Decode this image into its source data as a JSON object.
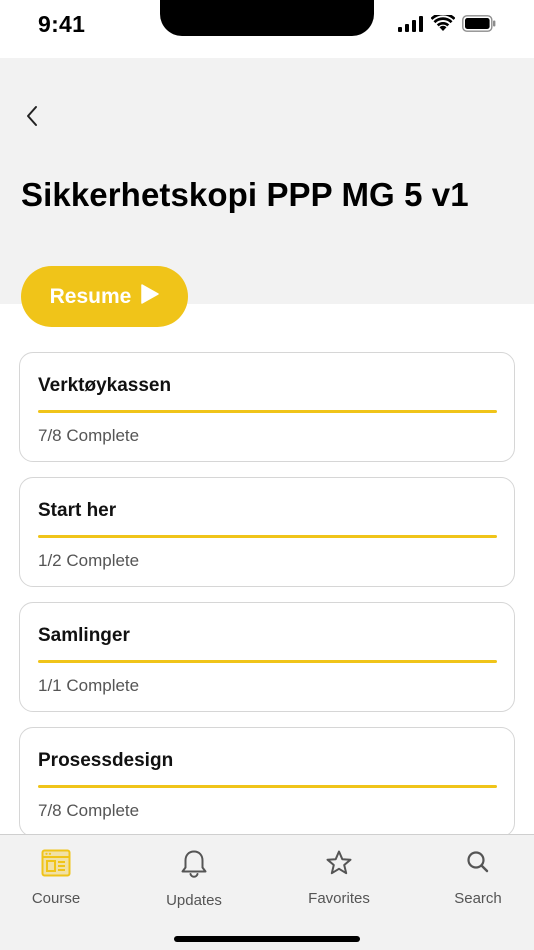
{
  "status_bar": {
    "time": "9:41"
  },
  "header": {
    "title": "Sikkerhetskopi PPP MG 5 v1",
    "back_icon": "chevron-left-icon"
  },
  "resume": {
    "label": "Resume",
    "icon": "play-icon"
  },
  "modules": [
    {
      "title": "Verktøykassen",
      "status": "7/8 Complete",
      "progress": 1.0
    },
    {
      "title": "Start her",
      "status": "1/2 Complete",
      "progress": 1.0
    },
    {
      "title": "Samlinger",
      "status": "1/1 Complete",
      "progress": 1.0
    },
    {
      "title": "Prosessdesign",
      "status": "7/8 Complete",
      "progress": 1.0
    }
  ],
  "tabs": [
    {
      "label": "Course",
      "icon": "course-icon",
      "active": true
    },
    {
      "label": "Updates",
      "icon": "bell-icon",
      "active": false
    },
    {
      "label": "Favorites",
      "icon": "star-icon",
      "active": false
    },
    {
      "label": "Search",
      "icon": "search-icon",
      "active": false
    }
  ],
  "colors": {
    "accent": "#f0c419",
    "header_bg": "#f2f2f2",
    "tab_bar_bg": "#f2f2f2"
  }
}
